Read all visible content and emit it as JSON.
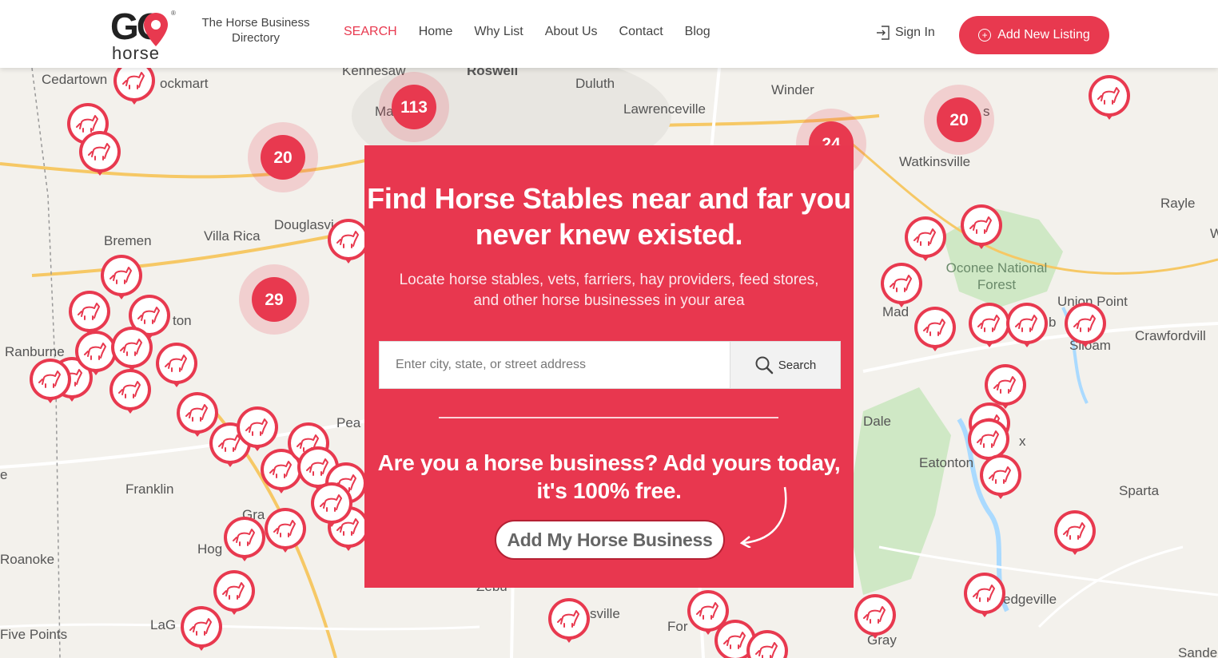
{
  "brand": {
    "logo_go": "GO",
    "logo_sub": "horse",
    "logo_reg": "®",
    "tagline": "The Horse Business Directory"
  },
  "nav": {
    "items": [
      "SEARCH",
      "Home",
      "Why List",
      "About Us",
      "Contact",
      "Blog"
    ],
    "active": "SEARCH"
  },
  "account": {
    "signin_label": "Sign In",
    "add_listing_label": "Add New Listing"
  },
  "hero": {
    "headline": "Find Horse Stables near and far you never knew existed.",
    "subtext": "Locate horse stables, vets, farriers, hay providers, feed stores, and other horse businesses in your area",
    "search_placeholder": "Enter city, state, or street address",
    "search_button": "Search",
    "business_headline": "Are you a horse business? Add yours today, it's 100% free.",
    "business_button": "Add My Horse Business"
  },
  "map": {
    "clusters": [
      "113",
      "20",
      "20",
      "29",
      "24"
    ],
    "places": [
      "Kennesaw",
      "Roswell",
      "Duluth",
      "Cedartown",
      "ockmart",
      "Lawrenceville",
      "Winder",
      "Watkinsville",
      "Rayle",
      "Bremen",
      "Villa Rica",
      "Douglasvi",
      "Oconee National Forest",
      "Union Point",
      "Crawfordvill",
      "Ranburne",
      "ton",
      "Mad",
      "Siloam",
      "Dale",
      "Eatonton",
      "Sparta",
      "Franklin",
      "Pea",
      "Roanoke",
      "Hog",
      "Gra",
      "LaG",
      "sville",
      "For",
      "edgeville",
      "Gray",
      "Five Points",
      "Sande",
      "W",
      "e",
      "Zebu",
      "Ma",
      "s",
      "x",
      "b"
    ],
    "colors": {
      "accent": "#e8394f",
      "water": "#aadaff",
      "forest": "#c8e6c0",
      "road": "#ffffff"
    }
  }
}
